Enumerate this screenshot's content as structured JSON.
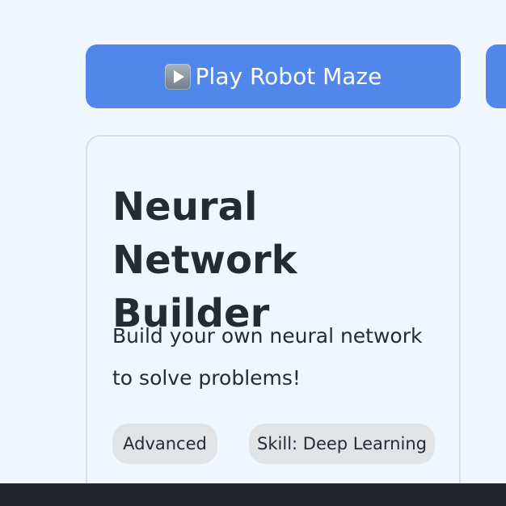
{
  "action_button": {
    "icon": "play-icon",
    "label": "Play Robot Maze"
  },
  "card": {
    "title": "Neural Network Builder",
    "description": "Build your own neural network to solve problems!",
    "tags": [
      {
        "label": "Advanced"
      },
      {
        "label": "Skill: Deep Learning"
      }
    ]
  },
  "colors": {
    "page_background": "#f0f6fe",
    "button_background": "#5187eb",
    "button_text": "#ffffff",
    "card_border": "#d9dee5",
    "text": "#262a35",
    "tag_background": "#e2e3e7",
    "footer_background": "#23262d"
  }
}
